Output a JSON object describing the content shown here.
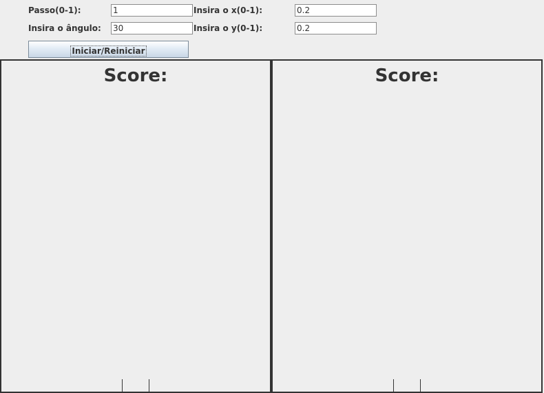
{
  "form": {
    "step_label": "Passo(0-1):",
    "step_value": "1",
    "angle_label": "Insira o ângulo:",
    "angle_value": "30",
    "x_label": "Insira o x(0-1):",
    "x_value": "0.2",
    "y_label": "Insira o y(0-1):",
    "y_value": "0.2",
    "start_button_label": "Iniciar/Reiniciar"
  },
  "panels": [
    {
      "score_label": "Score:"
    },
    {
      "score_label": "Score:"
    }
  ],
  "colors": {
    "background": "#eeeeee",
    "border": "#333333",
    "text": "#333333"
  }
}
